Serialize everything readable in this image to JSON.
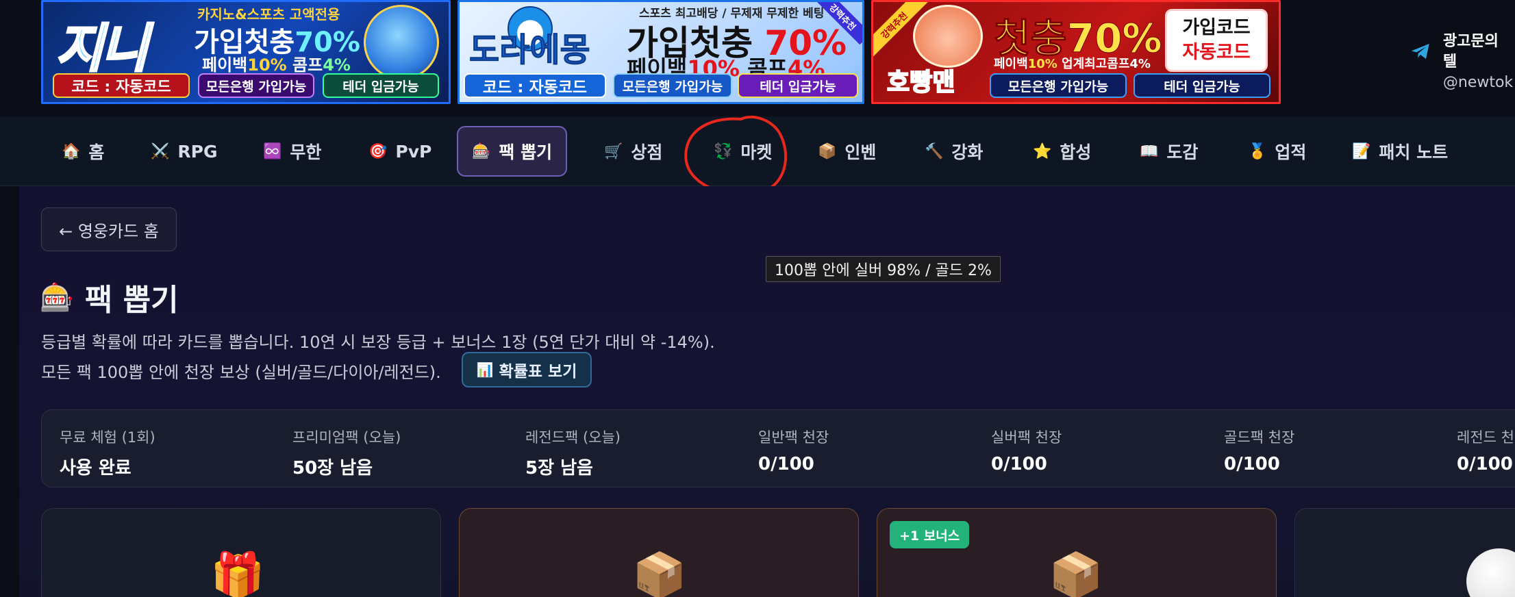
{
  "ads": [
    {
      "logo": "지니",
      "tag": "카지노&스포츠 고액전용",
      "headline": "가입첫충",
      "percent": "70%",
      "sub_prefix": "페이백",
      "sub_pct1": "10%",
      "sub_mid": " 콤프",
      "sub_pct2": "4%",
      "pill1": "코드 : 자동코드",
      "pill2": "모든은행 가입가능",
      "pill3": "테더 입금가능"
    },
    {
      "logo": "도라에몽",
      "tag": "스포츠 최고배당 / 무제재 무제한 베팅",
      "corner": "강력추천",
      "headline": "가입첫충",
      "percent": "70%",
      "sub_prefix": "페이백",
      "sub_pct1": "10%",
      "sub_mid": " 콤프",
      "sub_pct2": "4%",
      "pill1": "코드 : 자동코드",
      "pill2": "모든은행 가입가능",
      "pill3": "테더 입금가능"
    },
    {
      "ribbon": "강력추천",
      "logo": "호빵맨",
      "headline": "첫충70%",
      "tag_prefix": "페이백",
      "tag_pct": "10%",
      "tag_suffix": " 업계최고콤프4%",
      "code1": "가입코드",
      "code2": "자동코드",
      "pill2": "모든은행 가입가능",
      "pill3": "테더 입금가능"
    }
  ],
  "ad_info": {
    "line1": "광고문의 텔",
    "line2": "@newtok"
  },
  "nav": [
    {
      "icon": "🏠",
      "label": "홈"
    },
    {
      "icon": "⚔️",
      "label": "RPG"
    },
    {
      "icon": "♾️",
      "label": "무한"
    },
    {
      "icon": "🎯",
      "label": "PvP"
    },
    {
      "icon": "🎰",
      "label": "팩 뽑기"
    },
    {
      "icon": "🛒",
      "label": "상점"
    },
    {
      "icon": "💱",
      "label": "마켓"
    },
    {
      "icon": "📦",
      "label": "인벤"
    },
    {
      "icon": "🔨",
      "label": "강화"
    },
    {
      "icon": "⭐",
      "label": "합성"
    },
    {
      "icon": "📖",
      "label": "도감"
    },
    {
      "icon": "🏅",
      "label": "업적"
    },
    {
      "icon": "📝",
      "label": "패치 노트"
    }
  ],
  "back_label": "← 영웅카드 홈",
  "tooltip": "100뽑 안에 실버 98% / 골드 2%",
  "title": {
    "icon": "🎰",
    "text": "팩 뽑기"
  },
  "desc1": "등급별 확률에 따라 카드를 뽑습니다. 10연 시 보장 등급 + 보너스 1장 (5연 단가 대비 약 -14%).",
  "desc2": "모든 팩 100뽑 안에 천장 보상 (실버/골드/다이아/레전드).",
  "prob_button": {
    "icon": "📊",
    "label": "확률표 보기"
  },
  "stats": [
    {
      "label": "무료 체험 (1회)",
      "value": "사용 완료"
    },
    {
      "label": "프리미엄팩 (오늘)",
      "value": "50장 남음"
    },
    {
      "label": "레전드팩 (오늘)",
      "value": "5장 남음"
    },
    {
      "label": "일반팩 천장",
      "value": "0/100"
    },
    {
      "label": "실버팩 천장",
      "value": "0/100"
    },
    {
      "label": "골드팩 천장",
      "value": "0/100"
    },
    {
      "label": "레전드 천장",
      "value": "0/100"
    }
  ],
  "packs": [
    {
      "icon": "🎁"
    },
    {
      "icon": "📦"
    },
    {
      "icon": "📦",
      "badge": "+1 보너스"
    }
  ],
  "colors": {
    "accent": "#6d5fb8",
    "bonus": "#22b27a",
    "annotation": "#e8281c"
  }
}
